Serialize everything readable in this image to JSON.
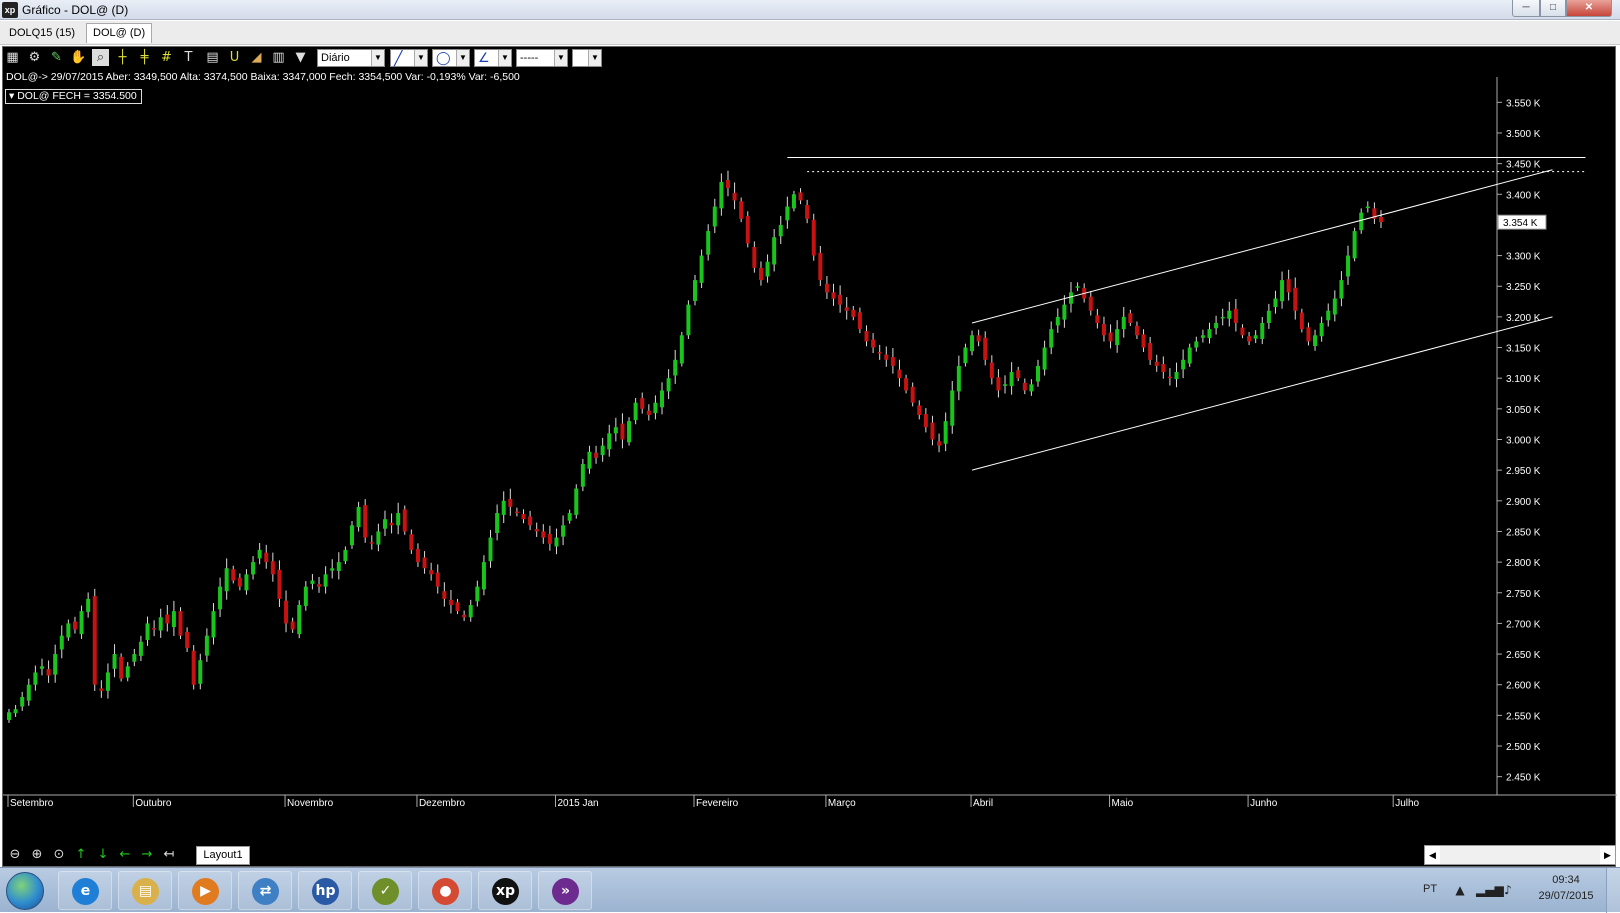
{
  "window": {
    "title": "Gráfico - DOL@ (D)",
    "logo": "xp",
    "min": "─",
    "max": "□",
    "close": "✕"
  },
  "tabs": [
    {
      "label": "DOLQ15 (15)"
    },
    {
      "label": "DOL@ (D)"
    }
  ],
  "toolbar": {
    "icons": [
      "chart-icon",
      "settings-icon",
      "draw-icon",
      "hand-icon",
      "zoom-select-icon",
      "crosshair-icon",
      "fibonacci-icon",
      "hash-icon",
      "text-icon",
      "calculator-icon",
      "magnet-icon",
      "eraser-icon",
      "trash-icon",
      "filter-icon"
    ],
    "period": "Diário",
    "line_style": "-----"
  },
  "info": {
    "ohlc": "DOL@-> 29/07/2015 Aber: 3349,500 Alta: 3374,500 Baixa: 3347,000 Fech: 3354,500 Var: -0,193% Var: -6,500",
    "legend": "DOL@ FECH = 3354.500",
    "last_price": "3.354 K"
  },
  "colors": {
    "up": "#19c41d",
    "down": "#c81212",
    "wick": "#dcdcdc",
    "bg": "#000000",
    "lines": "#ffffff"
  },
  "chart_data": {
    "type": "candlestick",
    "symbol": "DOL@",
    "ylim": [
      2425,
      3575
    ],
    "yticks": [
      "3.550 K",
      "3.500 K",
      "3.450 K",
      "3.400 K",
      "3.350 K",
      "3.300 K",
      "3.250 K",
      "3.200 K",
      "3.150 K",
      "3.100 K",
      "3.050 K",
      "3.000 K",
      "2.950 K",
      "2.900 K",
      "2.850 K",
      "2.800 K",
      "2.750 K",
      "2.700 K",
      "2.650 K",
      "2.600 K",
      "2.550 K",
      "2.500 K",
      "2.450 K"
    ],
    "months": [
      {
        "label": "Setembro",
        "index": 0
      },
      {
        "label": "Outubro",
        "index": 19
      },
      {
        "label": "Novembro",
        "index": 42
      },
      {
        "label": "Dezembro",
        "index": 62
      },
      {
        "label": "2015 Jan",
        "index": 83
      },
      {
        "label": "Fevereiro",
        "index": 104
      },
      {
        "label": "Março",
        "index": 124
      },
      {
        "label": "Abril",
        "index": 146
      },
      {
        "label": "Maio",
        "index": 167
      },
      {
        "label": "Junho",
        "index": 188
      },
      {
        "label": "Julho",
        "index": 210
      }
    ],
    "closes": [
      2555,
      2560,
      2580,
      2600,
      2620,
      2630,
      2615,
      2650,
      2680,
      2700,
      2690,
      2720,
      2740,
      2600,
      2590,
      2620,
      2650,
      2610,
      2630,
      2650,
      2670,
      2700,
      2690,
      2710,
      2700,
      2720,
      2680,
      2660,
      2600,
      2640,
      2680,
      2720,
      2760,
      2790,
      2770,
      2760,
      2780,
      2800,
      2820,
      2800,
      2780,
      2740,
      2700,
      2690,
      2730,
      2760,
      2770,
      2760,
      2780,
      2790,
      2800,
      2820,
      2860,
      2890,
      2840,
      2830,
      2850,
      2870,
      2860,
      2880,
      2850,
      2820,
      2800,
      2790,
      2780,
      2760,
      2740,
      2730,
      2720,
      2710,
      2730,
      2760,
      2800,
      2840,
      2880,
      2900,
      2890,
      2880,
      2870,
      2860,
      2850,
      2840,
      2830,
      2840,
      2860,
      2880,
      2920,
      2960,
      2980,
      2970,
      2990,
      3010,
      3020,
      3000,
      3030,
      3060,
      3050,
      3040,
      3060,
      3080,
      3100,
      3130,
      3170,
      3220,
      3260,
      3300,
      3340,
      3380,
      3420,
      3410,
      3390,
      3360,
      3320,
      3280,
      3260,
      3290,
      3330,
      3350,
      3380,
      3400,
      3390,
      3360,
      3300,
      3260,
      3240,
      3230,
      3220,
      3210,
      3200,
      3180,
      3160,
      3150,
      3140,
      3130,
      3120,
      3100,
      3080,
      3060,
      3040,
      3020,
      3000,
      2990,
      3030,
      3080,
      3120,
      3150,
      3170,
      3160,
      3130,
      3100,
      3080,
      3090,
      3110,
      3100,
      3080,
      3090,
      3120,
      3150,
      3180,
      3200,
      3220,
      3240,
      3250,
      3230,
      3210,
      3190,
      3170,
      3160,
      3180,
      3200,
      3190,
      3170,
      3150,
      3130,
      3120,
      3110,
      3100,
      3110,
      3130,
      3150,
      3160,
      3170,
      3180,
      3190,
      3200,
      3210,
      3190,
      3170,
      3160,
      3170,
      3190,
      3210,
      3230,
      3260,
      3240,
      3210,
      3180,
      3160,
      3170,
      3190,
      3210,
      3230,
      3260,
      3300,
      3340,
      3370,
      3380,
      3360,
      3354.5
    ],
    "trendlines": [
      {
        "name": "resistance",
        "style": "solid",
        "p1": {
          "index": 118,
          "price": 3460
        },
        "p2": {
          "index": 239,
          "price": 3460
        }
      },
      {
        "name": "dotted-resistance",
        "style": "dotted",
        "p1": {
          "index": 121,
          "price": 3437
        },
        "p2": {
          "index": 239,
          "price": 3437
        }
      },
      {
        "name": "channel-top",
        "style": "solid",
        "p1": {
          "index": 146,
          "price": 3190
        },
        "p2": {
          "index": 234,
          "price": 3440
        }
      },
      {
        "name": "channel-bottom",
        "style": "solid",
        "p1": {
          "index": 146,
          "price": 2950
        },
        "p2": {
          "index": 234,
          "price": 3200
        }
      }
    ]
  },
  "bottom": {
    "layout_tab": "Layout1",
    "nav_icons": [
      "zoom-out-icon",
      "zoom-in-icon",
      "zoom-reset-icon",
      "arrow-up-icon",
      "arrow-down-icon",
      "arrow-left-icon",
      "arrow-right-icon",
      "arrow-end-icon"
    ],
    "scroll_left": "◀",
    "scroll_right": "▶"
  },
  "taskbar": {
    "apps": [
      {
        "name": "ie",
        "glyph": "e",
        "color": "#1f7fd6"
      },
      {
        "name": "explorer",
        "glyph": "▤",
        "color": "#d9b04a"
      },
      {
        "name": "media-player",
        "glyph": "▶",
        "color": "#e07b1f"
      },
      {
        "name": "network",
        "glyph": "⇄",
        "color": "#3f7fc4"
      },
      {
        "name": "hp",
        "glyph": "hp",
        "color": "#2a5aa5"
      },
      {
        "name": "files",
        "glyph": "✓",
        "color": "#6f8f2a"
      },
      {
        "name": "chrome",
        "glyph": "●",
        "color": "#d44a32"
      },
      {
        "name": "xp",
        "glyph": "xp",
        "color": "#111111"
      },
      {
        "name": "arrow-app",
        "glyph": "»",
        "color": "#6d2a8f"
      }
    ],
    "lang": "PT",
    "time": "09:34",
    "date": "29/07/2015"
  }
}
